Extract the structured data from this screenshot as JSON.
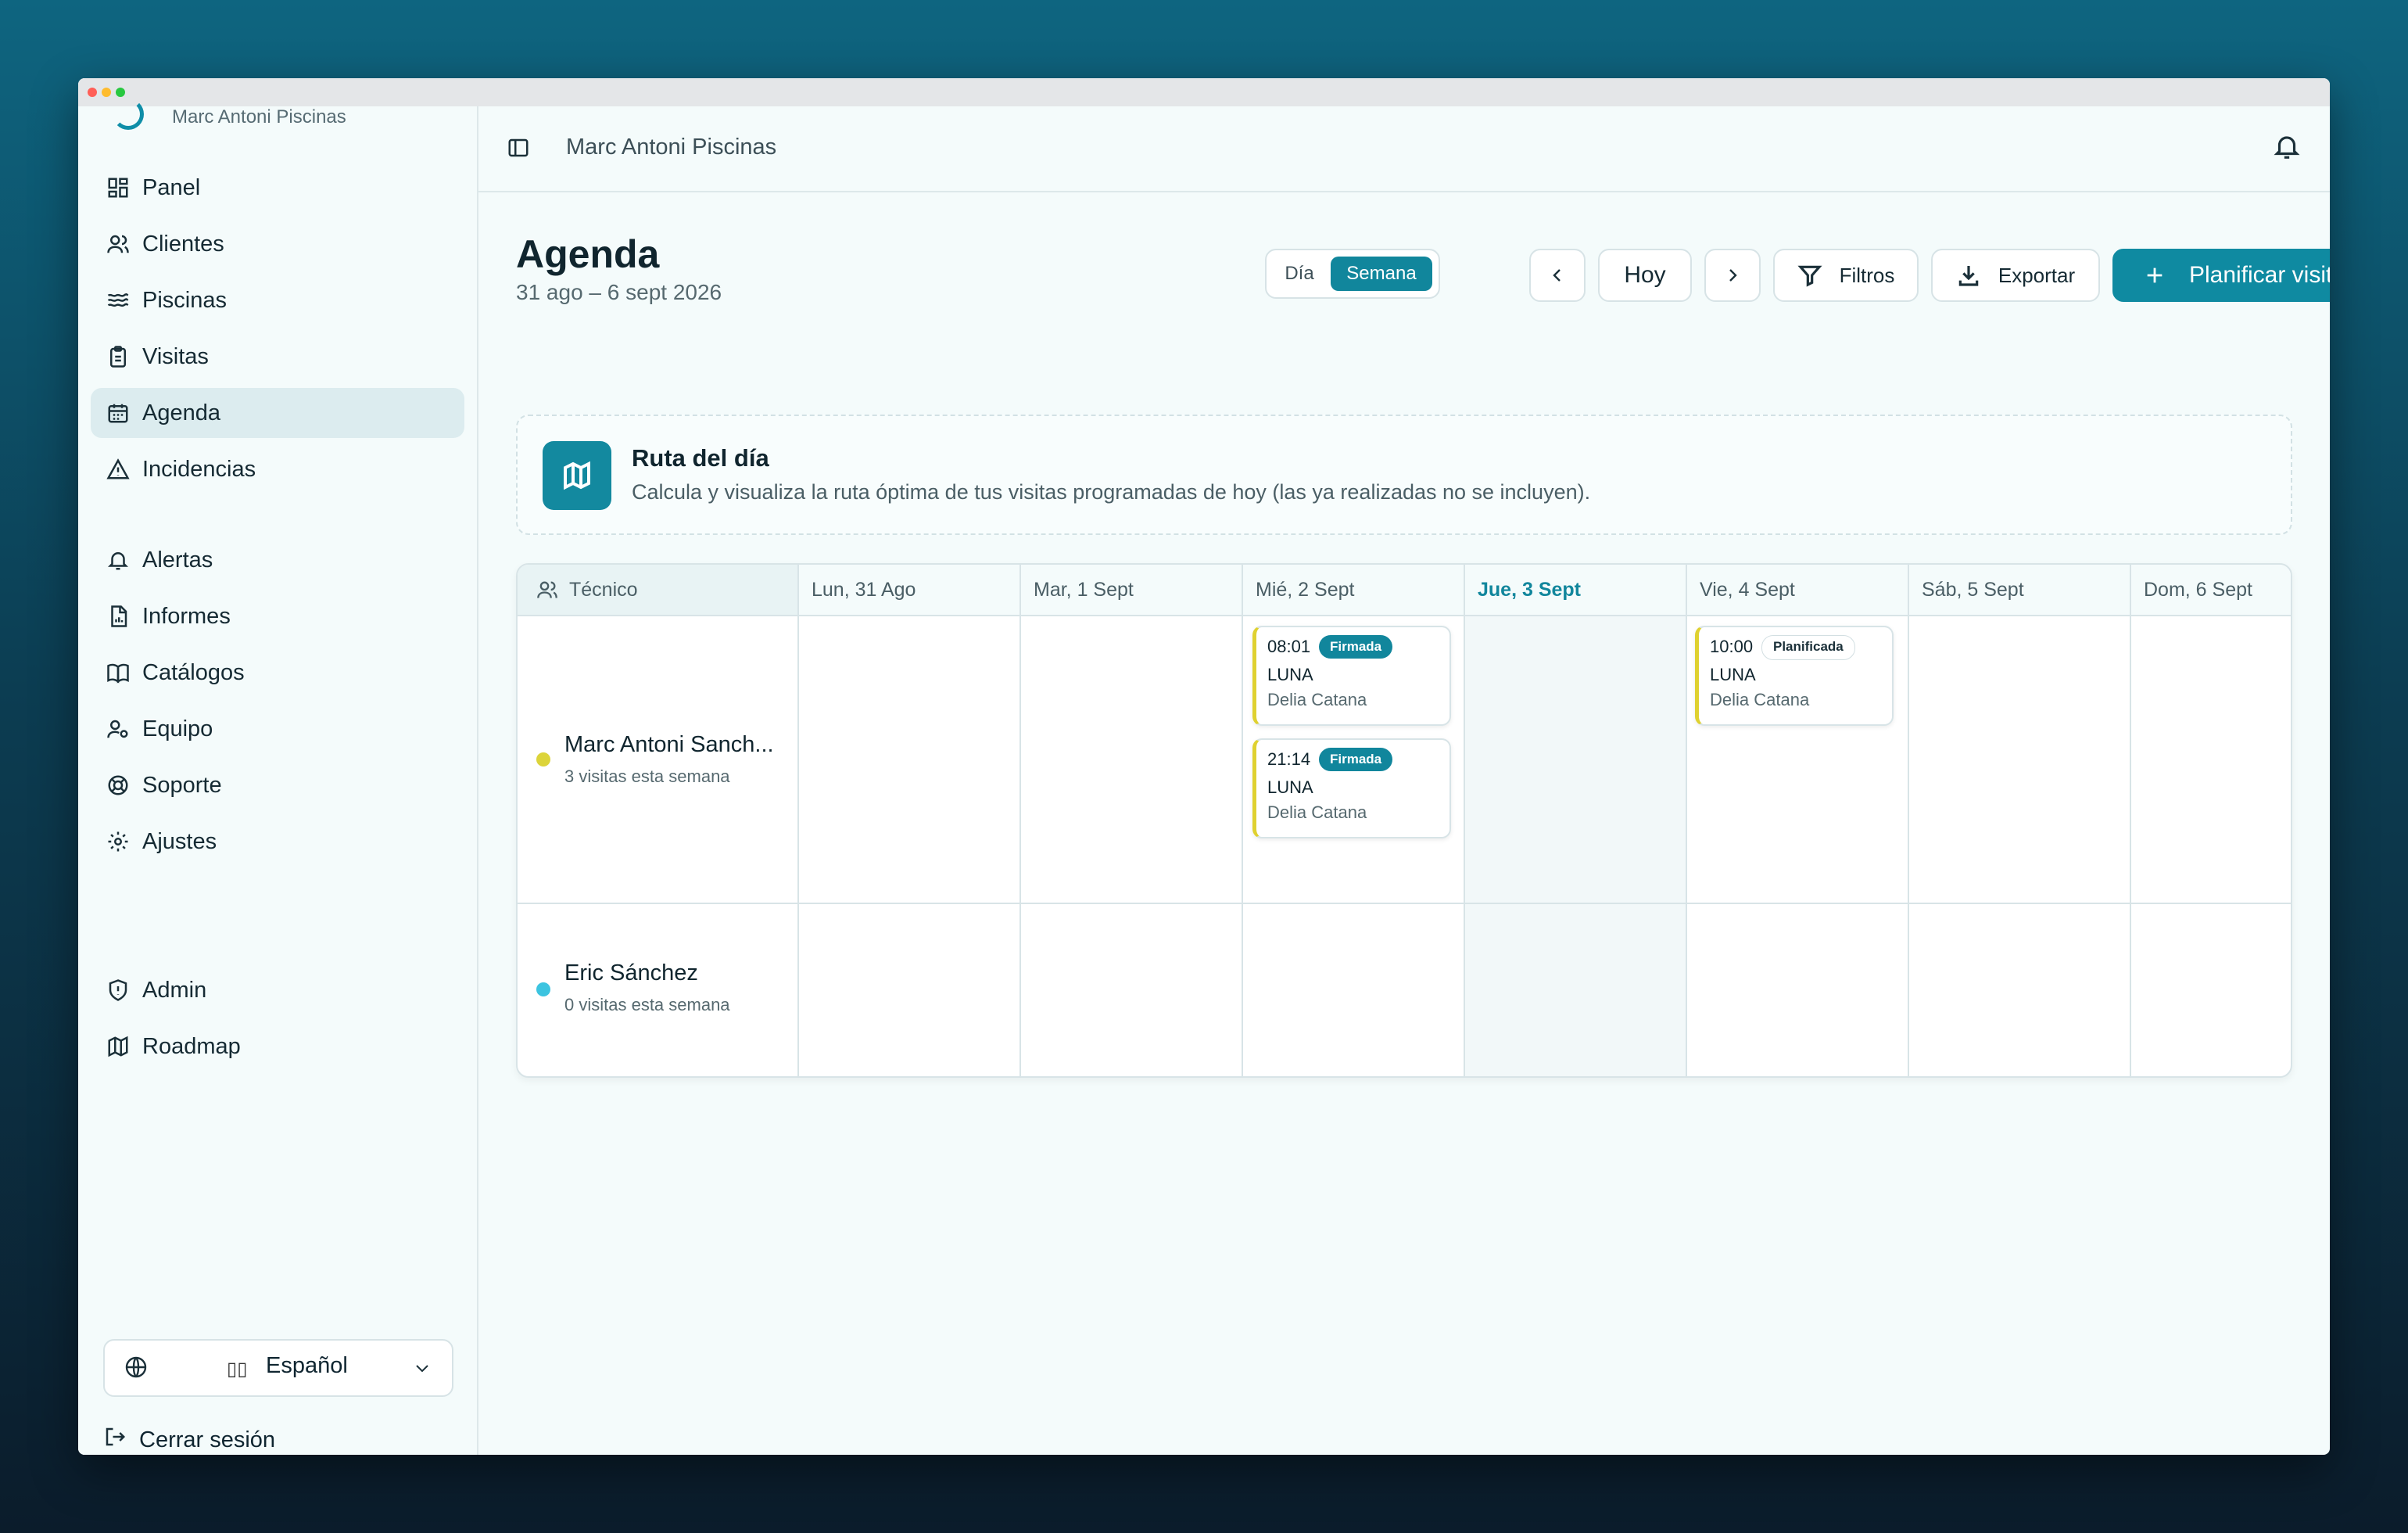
{
  "app": {
    "org_name": "Marc Antoni Piscinas",
    "breadcrumb": "Marc Antoni Piscinas"
  },
  "sidebar": {
    "group1": [
      {
        "label": "Panel",
        "icon": "dashboard-icon"
      },
      {
        "label": "Clientes",
        "icon": "users-icon"
      },
      {
        "label": "Piscinas",
        "icon": "waves-icon"
      },
      {
        "label": "Visitas",
        "icon": "clipboard-icon"
      },
      {
        "label": "Agenda",
        "icon": "calendar-icon",
        "active": true
      },
      {
        "label": "Incidencias",
        "icon": "warning-icon"
      }
    ],
    "group2": [
      {
        "label": "Alertas",
        "icon": "bell-icon"
      },
      {
        "label": "Informes",
        "icon": "report-icon"
      },
      {
        "label": "Catálogos",
        "icon": "book-icon"
      },
      {
        "label": "Equipo",
        "icon": "team-icon"
      },
      {
        "label": "Soporte",
        "icon": "lifebuoy-icon"
      },
      {
        "label": "Ajustes",
        "icon": "gear-icon"
      }
    ],
    "group3": [
      {
        "label": "Admin",
        "icon": "shield-icon"
      },
      {
        "label": "Roadmap",
        "icon": "map-icon"
      }
    ],
    "language": {
      "flag": "▯▯",
      "value": "Español"
    },
    "logout": "Cerrar sesión"
  },
  "page": {
    "title": "Agenda",
    "subtitle": "31 ago – 6 sept 2026",
    "view_day": "Día",
    "view_week": "Semana",
    "today_button": "Hoy",
    "filters_button": "Filtros",
    "export_button": "Exportar",
    "plan_button": "Planificar visita"
  },
  "route": {
    "title": "Ruta del día",
    "description": "Calcula y visualiza la ruta óptima de tus visitas programadas de hoy (las ya realizadas no se incluyen)."
  },
  "calendar": {
    "tech_header": "Técnico",
    "days": [
      "Lun, 31 Ago",
      "Mar, 1 Sept",
      "Mié, 2 Sept",
      "Jue, 3 Sept",
      "Vie, 4 Sept",
      "Sáb, 5 Sept",
      "Dom, 6 Sept"
    ],
    "today_index": 3,
    "technicians": [
      {
        "name": "Marc Antoni Sanch...",
        "count": "3 visitas esta semana",
        "color": "#dcd43a"
      },
      {
        "name": "Eric Sánchez",
        "count": "0 visitas esta semana",
        "color": "#3cc4e0"
      }
    ],
    "visits": [
      {
        "tech": 0,
        "day": 2,
        "time": "08:01",
        "status": "Firmada",
        "pool": "LUNA",
        "client": "Delia Catana"
      },
      {
        "tech": 0,
        "day": 2,
        "time": "21:14",
        "status": "Firmada",
        "pool": "LUNA",
        "client": "Delia Catana"
      },
      {
        "tech": 0,
        "day": 4,
        "time": "10:00",
        "status": "Planificada",
        "pool": "LUNA",
        "client": "Delia Catana"
      }
    ]
  },
  "colors": {
    "accent": "#11869c",
    "visit_border": "#dfd130"
  }
}
